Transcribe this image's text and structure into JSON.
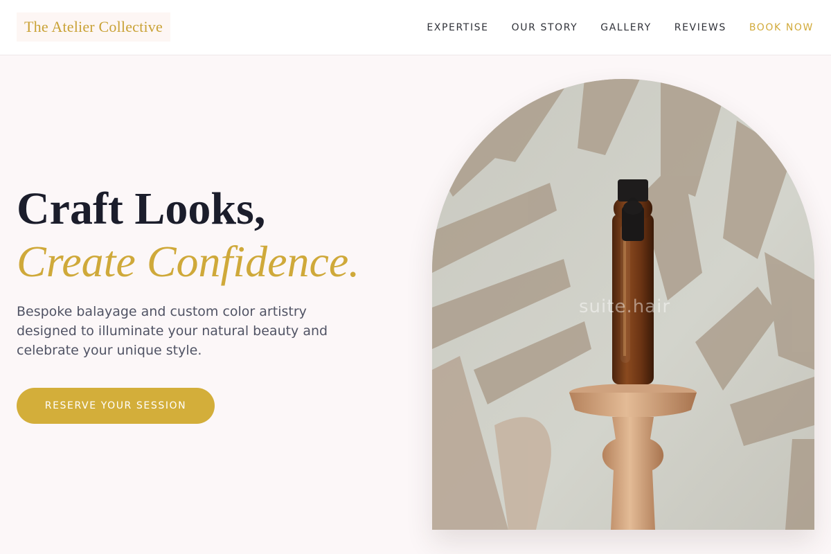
{
  "header": {
    "logo_text": "The Atelier Collective",
    "nav": [
      {
        "label": "EXPERTISE"
      },
      {
        "label": "OUR STORY"
      },
      {
        "label": "GALLERY"
      },
      {
        "label": "REVIEWS"
      },
      {
        "label": "BOOK NOW"
      }
    ]
  },
  "hero": {
    "headline_line1": "Craft Looks,",
    "headline_line2": "Create Confidence.",
    "subtext": "Bespoke balayage and custom color artistry designed to illuminate your natural beauty and celebrate your unique style.",
    "cta_label": "RESERVE YOUR SESSION",
    "image": {
      "watermark": "suite.hair",
      "subject": "amber dropper bottle on wooden pedestal with palm shadows"
    }
  },
  "colors": {
    "accent_gold": "#d3ae3a",
    "headline_dark": "#1b1d2b",
    "background": "#fcf7f8"
  }
}
